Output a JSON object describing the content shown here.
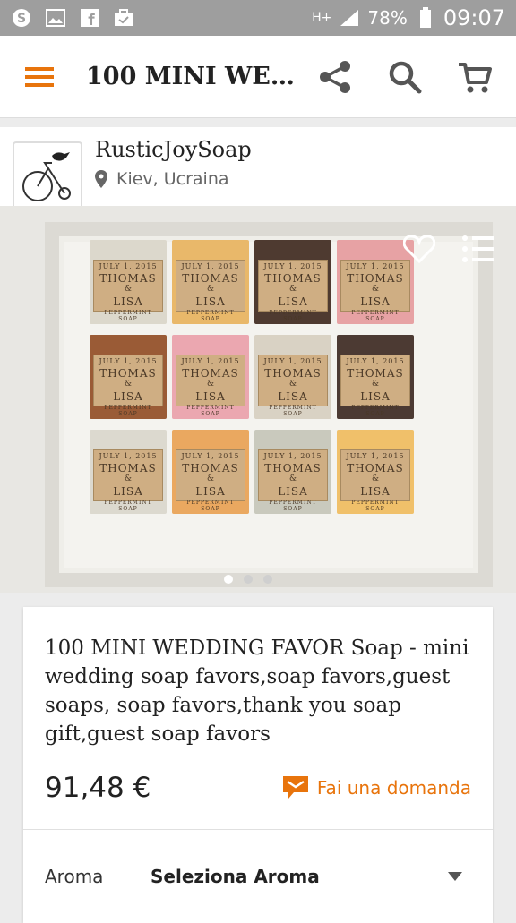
{
  "status": {
    "battery": "78%",
    "time": "09:07",
    "network": "H+"
  },
  "appbar": {
    "title": "100 MINI WED…"
  },
  "shop": {
    "name": "RusticJoySoap",
    "location": "Kiev, Ucraina"
  },
  "soaps": [
    {
      "color": "#dcd8cc",
      "date": "JULY 1, 2015",
      "names": "THOMAS",
      "amp": "&",
      "second": "LISA",
      "sub": "PEPPERMINT SOAP"
    },
    {
      "color": "#e9b86a",
      "date": "JULY 1, 2015",
      "names": "THOMAS",
      "amp": "&",
      "second": "LISA",
      "sub": "PEPPERMINT SOAP"
    },
    {
      "color": "#4e3a30",
      "date": "JULY 1, 2015",
      "names": "THOMAS",
      "amp": "&",
      "second": "LISA",
      "sub": "PEPPERMINT SOAP"
    },
    {
      "color": "#e7a2a4",
      "date": "JULY 1, 2015",
      "names": "THOMAS",
      "amp": "&",
      "second": "LISA",
      "sub": "PEPPERMINT SOAP"
    },
    {
      "color": "#9a5b36",
      "date": "JULY 1, 2015",
      "names": "THOMAS",
      "amp": "&",
      "second": "LISA",
      "sub": "PEPPERMINT SOAP"
    },
    {
      "color": "#eba7b0",
      "date": "JULY 1, 2015",
      "names": "THOMAS",
      "amp": "&",
      "second": "LISA",
      "sub": "PEPPERMINT SOAP"
    },
    {
      "color": "#d9d2c4",
      "date": "JULY 1, 2015",
      "names": "THOMAS",
      "amp": "&",
      "second": "LISA",
      "sub": "PEPPERMINT SOAP"
    },
    {
      "color": "#4c3a33",
      "date": "JULY 1, 2015",
      "names": "THOMAS",
      "amp": "&",
      "second": "LISA",
      "sub": "PEPPERMINT SOAP"
    },
    {
      "color": "#dcd9cf",
      "date": "JULY 1, 2015",
      "names": "THOMAS",
      "amp": "&",
      "second": "LISA",
      "sub": "PEPPERMINT SOAP"
    },
    {
      "color": "#eaa860",
      "date": "JULY 1, 2015",
      "names": "THOMAS",
      "amp": "&",
      "second": "LISA",
      "sub": "PEPPERMINT SOAP"
    },
    {
      "color": "#c9c9bd",
      "date": "JULY 1, 2015",
      "names": "THOMAS",
      "amp": "&",
      "second": "LISA",
      "sub": "PEPPERMINT SOAP"
    },
    {
      "color": "#f0c06a",
      "date": "JULY 1, 2015",
      "names": "THOMAS",
      "amp": "&",
      "second": "LISA",
      "sub": "PEPPERMINT SOAP"
    }
  ],
  "product": {
    "title": "100 MINI WEDDING FAVOR Soap - mini wedding soap favors,soap favors,guest soaps, soap favors,thank you soap gift,guest soap favors",
    "price": "91,48 €",
    "ask_label": "Fai una domanda"
  },
  "variation": {
    "label": "Aroma",
    "value": "Seleziona Aroma"
  },
  "colors": {
    "accent": "#e8740c",
    "statusbar": "#9e9e9e"
  }
}
